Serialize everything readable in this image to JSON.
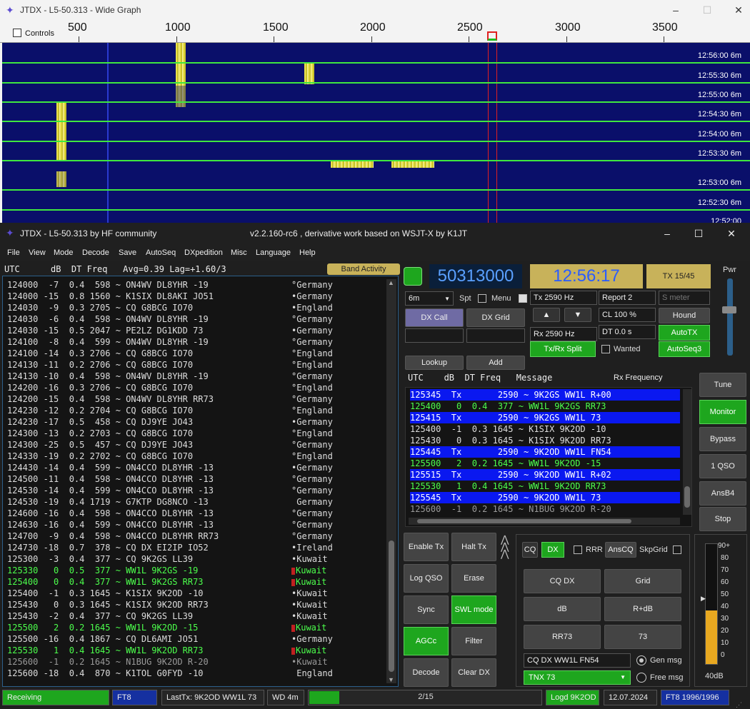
{
  "wide_graph": {
    "title": "JTDX - L5-50.313 - Wide Graph",
    "controls_label": "Controls",
    "freq_ticks": [
      "500",
      "1000",
      "1500",
      "2000",
      "2500",
      "3000",
      "3500"
    ],
    "times": [
      "12:56:00",
      "12:55:30",
      "12:55:00",
      "12:54:30",
      "12:54:00",
      "12:53:30",
      "12:53:00",
      "12:52:30",
      "12:52:00"
    ],
    "band_suffix": "6m"
  },
  "main": {
    "title": "JTDX - L5-50.313  by HF community",
    "subtitle": "v2.2.160-rc6 , derivative work based on WSJT-X by K1JT",
    "menus": [
      "File",
      "View",
      "Mode",
      "Decode",
      "Save",
      "AutoSeq",
      "DXpedition",
      "Misc",
      "Language",
      "Help"
    ]
  },
  "left_panel": {
    "header": "UTC      dB  DT Freq   Avg=0.39 Lag=+1.60/3",
    "band_activity": "Band Activity",
    "rows": [
      {
        "text": "124000  -7  0.4  598 ~ ON4WV DL8YHR -19",
        "country": "°Germany",
        "color": "#ddd",
        "mark": false
      },
      {
        "text": "124000 -15  0.8 1560 ~ K1SIX DL8AKI JO51",
        "country": "•Germany",
        "color": "#ddd",
        "mark": false
      },
      {
        "text": "124030  -9  0.3 2705 ~ CQ G8BCG IO70",
        "country": "•England",
        "color": "#ddd",
        "mark": false
      },
      {
        "text": "124030  -6  0.4  598 ~ ON4WV DL8YHR -19",
        "country": "°Germany",
        "color": "#ddd",
        "mark": false
      },
      {
        "text": "124030 -15  0.5 2047 ~ PE2LZ DG1KDD 73",
        "country": "•Germany",
        "color": "#ddd",
        "mark": false
      },
      {
        "text": "124100  -8  0.4  599 ~ ON4WV DL8YHR -19",
        "country": "°Germany",
        "color": "#ddd",
        "mark": false
      },
      {
        "text": "124100 -14  0.3 2706 ~ CQ G8BCG IO70",
        "country": "°England",
        "color": "#ddd",
        "mark": false
      },
      {
        "text": "124130 -11  0.2 2706 ~ CQ G8BCG IO70",
        "country": "°England",
        "color": "#ddd",
        "mark": false
      },
      {
        "text": "124130 -10  0.4  598 ~ ON4WV DL8YHR -19",
        "country": "°Germany",
        "color": "#ddd",
        "mark": false
      },
      {
        "text": "124200 -16  0.3 2706 ~ CQ G8BCG IO70",
        "country": "°England",
        "color": "#ddd",
        "mark": false
      },
      {
        "text": "124200 -15  0.4  598 ~ ON4WV DL8YHR RR73",
        "country": "°Germany",
        "color": "#ddd",
        "mark": false
      },
      {
        "text": "124230 -12  0.2 2704 ~ CQ G8BCG IO70",
        "country": "°England",
        "color": "#ddd",
        "mark": false
      },
      {
        "text": "124230 -17  0.5  458 ~ CQ DJ9YE JO43",
        "country": "•Germany",
        "color": "#ddd",
        "mark": false
      },
      {
        "text": "124300 -13  0.2 2703 ~ CQ G8BCG IO70",
        "country": "°England",
        "color": "#ddd",
        "mark": false
      },
      {
        "text": "124300 -25  0.5  457 ~ CQ DJ9YE JO43",
        "country": "°Germany",
        "color": "#ddd",
        "mark": false
      },
      {
        "text": "124330 -19  0.2 2702 ~ CQ G8BCG IO70",
        "country": "°England",
        "color": "#ddd",
        "mark": false
      },
      {
        "text": "124430 -14  0.4  599 ~ ON4CCO DL8YHR -13",
        "country": "•Germany",
        "color": "#ddd",
        "mark": false
      },
      {
        "text": "124500 -11  0.4  598 ~ ON4CCO DL8YHR -13",
        "country": "°Germany",
        "color": "#ddd",
        "mark": false
      },
      {
        "text": "124530 -14  0.4  599 ~ ON4CCO DL8YHR -13",
        "country": "°Germany",
        "color": "#ddd",
        "mark": false
      },
      {
        "text": "124530 -19  0.4 1719 ~ G7KTP DG8NCO -13",
        "country": " Germany",
        "color": "#ddd",
        "mark": false
      },
      {
        "text": "124600 -16  0.4  598 ~ ON4CCO DL8YHR -13",
        "country": "°Germany",
        "color": "#ddd",
        "mark": false
      },
      {
        "text": "124630 -16  0.4  599 ~ ON4CCO DL8YHR -13",
        "country": "°Germany",
        "color": "#ddd",
        "mark": false
      },
      {
        "text": "124700  -9  0.4  598 ~ ON4CCO DL8YHR RR73",
        "country": "°Germany",
        "color": "#ddd",
        "mark": false
      },
      {
        "text": "124730 -18  0.7  378 ~ CQ DX EI2IP IO52",
        "country": "•Ireland",
        "color": "#ddd",
        "mark": false
      },
      {
        "text": "125300  -3  0.4  377 ~ CQ 9K2GS LL39",
        "country": "•Kuwait",
        "color": "#ddd",
        "mark": false
      },
      {
        "text": "125330   0  0.5  377 ~ WW1L 9K2GS -19",
        "country": "Kuwait",
        "color": "#4cff4c",
        "mark": true
      },
      {
        "text": "125400   0  0.4  377 ~ WW1L 9K2GS RR73",
        "country": "Kuwait",
        "color": "#4cff4c",
        "mark": true
      },
      {
        "text": "125400  -1  0.3 1645 ~ K1SIX 9K2OD -10",
        "country": "•Kuwait",
        "color": "#ddd",
        "mark": false
      },
      {
        "text": "125430   0  0.3 1645 ~ K1SIX 9K2OD RR73",
        "country": "•Kuwait",
        "color": "#ddd",
        "mark": false
      },
      {
        "text": "125430  -2  0.4  377 ~ CQ 9K2GS LL39",
        "country": "•Kuwait",
        "color": "#ddd",
        "mark": false
      },
      {
        "text": "125500   2  0.2 1645 ~ WW1L 9K2OD -15",
        "country": "Kuwait",
        "color": "#4cff4c",
        "mark": true
      },
      {
        "text": "125500 -16  0.4 1867 ~ CQ DL6AMI JO51",
        "country": "•Germany",
        "color": "#ddd",
        "mark": false
      },
      {
        "text": "125530   1  0.4 1645 ~ WW1L 9K2OD RR73",
        "country": "Kuwait",
        "color": "#4cff4c",
        "mark": true
      },
      {
        "text": "125600  -1  0.2 1645 ~ N1BUG 9K2OD R-20",
        "country": "•Kuwait",
        "color": "#999",
        "mark": false
      },
      {
        "text": "125600 -18  0.4  870 ~ K1TOL G0FYD -10",
        "country": " England",
        "color": "#ddd",
        "mark": false
      }
    ]
  },
  "controls": {
    "freq": "50313000",
    "clock": "12:56:17",
    "tx_period": "TX 15/45",
    "pwr": "Pwr",
    "band": "6m",
    "spt": "Spt",
    "menu": "Menu",
    "tx_hz": "Tx  2590  Hz",
    "rx_hz": "Rx  2590  Hz",
    "report": "Report 2",
    "smeter": "S meter",
    "cl": "CL  100 %",
    "dt": "DT 0.0 s",
    "dx_call": "DX Call",
    "dx_grid": "DX Grid",
    "hound": "Hound",
    "autotx": "AutoTX",
    "txrx_split": "Tx/Rx Split",
    "wanted": "Wanted",
    "autoseq3": "AutoSeq3",
    "lookup": "Lookup",
    "add": "Add",
    "up": "▲",
    "down": "▼"
  },
  "rx_panel": {
    "header": "UTC    dB  DT Freq   Message",
    "header_rx": "Rx Frequency",
    "rows": [
      {
        "text": "125345  Tx       2590 ~ 9K2GS WW1L R+00",
        "bg": "#0a18f0",
        "color": "#fff"
      },
      {
        "text": "125400   0  0.4  377 ~ WW1L 9K2GS RR73",
        "bg": "",
        "color": "#4cff4c"
      },
      {
        "text": "125415  Tx       2590 ~ 9K2GS WW1L 73",
        "bg": "#0a18f0",
        "color": "#fff"
      },
      {
        "text": "125400  -1  0.3 1645 ~ K1SIX 9K2OD -10",
        "bg": "",
        "color": "#ddd"
      },
      {
        "text": "125430   0  0.3 1645 ~ K1SIX 9K2OD RR73",
        "bg": "",
        "color": "#ddd"
      },
      {
        "text": "125445  Tx       2590 ~ 9K2OD WW1L FN54",
        "bg": "#0a18f0",
        "color": "#fff"
      },
      {
        "text": "125500   2  0.2 1645 ~ WW1L 9K2OD -15",
        "bg": "",
        "color": "#4cff4c"
      },
      {
        "text": "125515  Tx       2590 ~ 9K2OD WW1L R+02",
        "bg": "#0a18f0",
        "color": "#fff"
      },
      {
        "text": "125530   1  0.4 1645 ~ WW1L 9K2OD RR73",
        "bg": "",
        "color": "#4cff4c"
      },
      {
        "text": "125545  Tx       2590 ~ 9K2OD WW1L 73",
        "bg": "#0a18f0",
        "color": "#fff"
      },
      {
        "text": "125600  -1  0.2 1645 ~ N1BUG 9K2OD R-20",
        "bg": "",
        "color": "#999"
      }
    ]
  },
  "right_buttons": [
    "Tune",
    "Monitor",
    "Bypass",
    "1 QSO",
    "AnsB4",
    "Stop"
  ],
  "bottom_buttons": {
    "enable_tx": "Enable Tx",
    "halt_tx": "Halt Tx",
    "log_qso": "Log QSO",
    "erase": "Erase",
    "sync": "Sync",
    "swl_mode": "SWL mode",
    "agcc": "AGCc",
    "filter": "Filter",
    "decode": "Decode",
    "clear_dx": "Clear DX"
  },
  "tx_panel": {
    "cq": "CQ",
    "dx": "DX",
    "rrr": "RRR",
    "anscq": "AnsCQ",
    "skpgrid": "SkpGrid",
    "cq_dx": "CQ DX",
    "grid": "Grid",
    "db": "dB",
    "r_db": "R+dB",
    "rr73": "RR73",
    "s73": "73",
    "msg": "CQ DX WW1L FN54",
    "gen_msg": "Gen msg",
    "tnx": "TNX 73",
    "free_msg": "Free msg"
  },
  "meter": {
    "ticks": [
      "90+",
      "80",
      "70",
      "60",
      "50",
      "40",
      "30",
      "20",
      "10",
      "0"
    ],
    "label": "40dB",
    "level_db": 40
  },
  "status": {
    "receiving": "Receiving",
    "mode": "FT8",
    "lasttx": "LastTx: 9K2OD WW1L 73",
    "wd": "WD 4m",
    "progress": "2/15",
    "progress_fraction": 0.13,
    "logd": "Logd 9K2OD",
    "date": "12.07.2024",
    "ft8_count": "FT8  1996/1996"
  },
  "colors": {
    "green": "#1ea61e",
    "blue_tx": "#0a18f0",
    "yellow_btn": "#c8b25a",
    "accent_blue": "#2c5f8a"
  }
}
